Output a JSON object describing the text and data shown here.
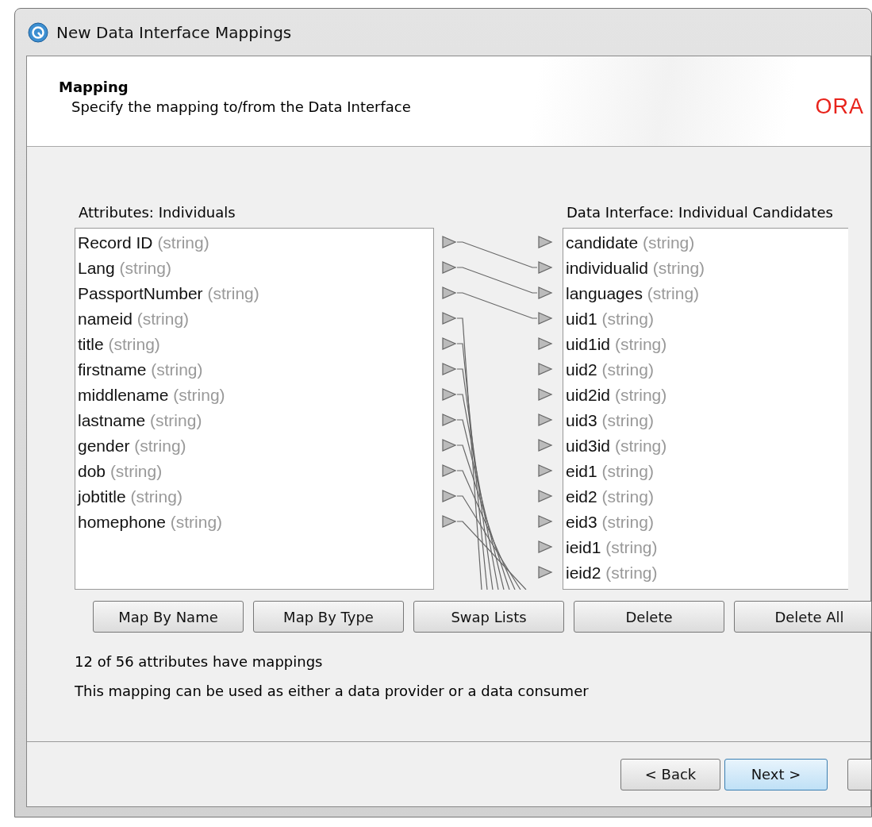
{
  "window": {
    "title": "New Data Interface Mappings"
  },
  "header": {
    "title": "Mapping",
    "subtitle": "Specify the mapping to/from the Data Interface",
    "logo": "ORA"
  },
  "source": {
    "label": "Attributes: Individuals",
    "items": [
      {
        "name": "Record ID",
        "type": "(string)"
      },
      {
        "name": "Lang",
        "type": "(string)"
      },
      {
        "name": "PassportNumber",
        "type": "(string)"
      },
      {
        "name": "nameid",
        "type": "(string)"
      },
      {
        "name": "title",
        "type": "(string)"
      },
      {
        "name": "firstname",
        "type": "(string)"
      },
      {
        "name": "middlename",
        "type": "(string)"
      },
      {
        "name": "lastname",
        "type": "(string)"
      },
      {
        "name": "gender",
        "type": "(string)"
      },
      {
        "name": "dob",
        "type": "(string)"
      },
      {
        "name": "jobtitle",
        "type": "(string)"
      },
      {
        "name": "homephone",
        "type": "(string)"
      }
    ]
  },
  "target": {
    "label": "Data Interface: Individual Candidates",
    "items": [
      {
        "name": "candidate",
        "type": "(string)"
      },
      {
        "name": "individualid",
        "type": "(string)"
      },
      {
        "name": "languages",
        "type": "(string)"
      },
      {
        "name": "uid1",
        "type": "(string)"
      },
      {
        "name": "uid1id",
        "type": "(string)"
      },
      {
        "name": "uid2",
        "type": "(string)"
      },
      {
        "name": "uid2id",
        "type": "(string)"
      },
      {
        "name": "uid3",
        "type": "(string)"
      },
      {
        "name": "uid3id",
        "type": "(string)"
      },
      {
        "name": "eid1",
        "type": "(string)"
      },
      {
        "name": "eid2",
        "type": "(string)"
      },
      {
        "name": "eid3",
        "type": "(string)"
      },
      {
        "name": "ieid1",
        "type": "(string)"
      },
      {
        "name": "ieid2",
        "type": "(string)"
      }
    ]
  },
  "actions": [
    "Map By Name",
    "Map By Type",
    "Swap Lists",
    "Delete",
    "Delete All"
  ],
  "status": [
    "12 of 56 attributes have mappings",
    "This mapping can be used as either a data provider or a data consumer"
  ],
  "footer_buttons": [
    {
      "label": "< Back",
      "selected": false
    },
    {
      "label": "Next >",
      "selected": true
    },
    {
      "selected": false
    }
  ]
}
